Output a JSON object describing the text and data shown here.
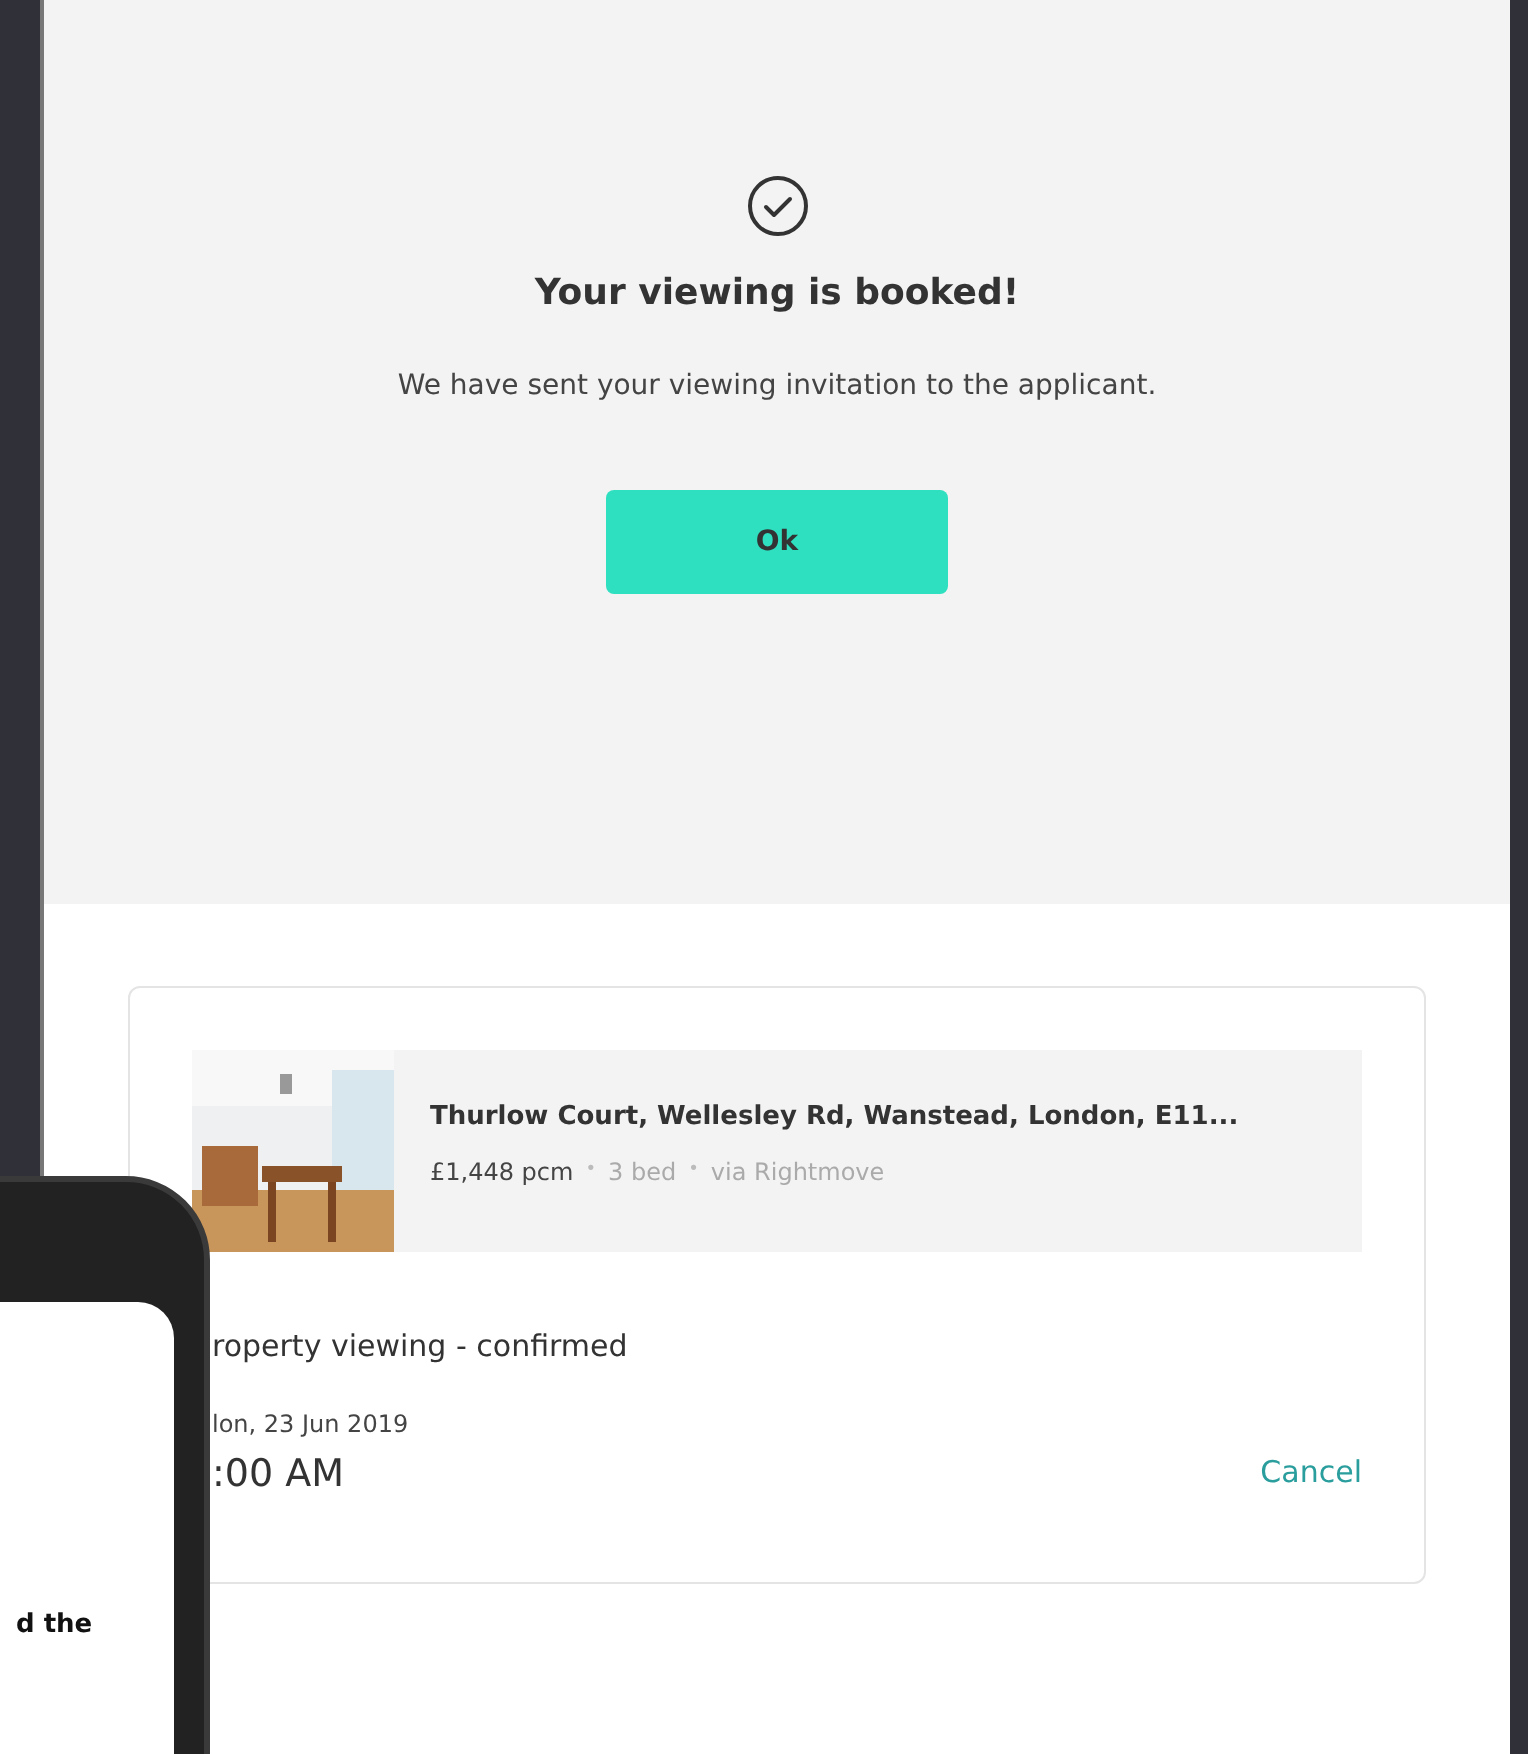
{
  "modal": {
    "title": "Your viewing is booked!",
    "message": "We have sent your viewing invitation to the applicant.",
    "ok_button": "Ok"
  },
  "booking": {
    "address": "Thurlow Court, Wellesley Rd, Wanstead, London, E11...",
    "price": "£1,448 pcm",
    "details": [
      "3 bed",
      "via Rightmove"
    ],
    "separator": "•",
    "status": "roperty viewing - confirmed",
    "date": "lon, 23 Jun 2019",
    "time": ":00 AM",
    "cancel": "Cancel"
  },
  "phone": {
    "text": "d the"
  }
}
